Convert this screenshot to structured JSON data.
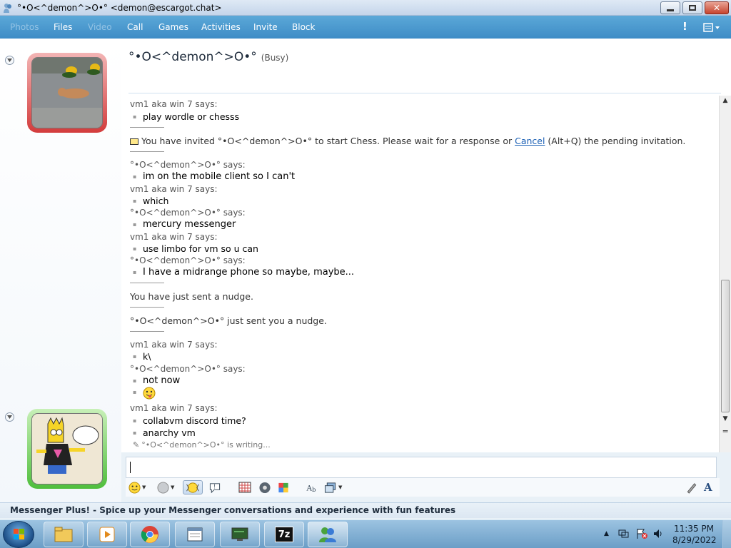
{
  "window": {
    "title": "°•Ο<^demon^>Ο•° <demon@escargot.chat>"
  },
  "menu": {
    "items": [
      {
        "label": "Photos",
        "disabled": true
      },
      {
        "label": "Files",
        "disabled": false
      },
      {
        "label": "Video",
        "disabled": true
      },
      {
        "label": "Call",
        "disabled": false
      },
      {
        "label": "Games",
        "disabled": false
      },
      {
        "label": "Activities",
        "disabled": false
      },
      {
        "label": "Invite",
        "disabled": false
      },
      {
        "label": "Block",
        "disabled": false
      }
    ],
    "alert_symbol": "!"
  },
  "contact": {
    "name": "°•Ο<^demon^>Ο•°",
    "status": "(Busy)"
  },
  "conversation": {
    "first_sender": "vm1 aka win 7 says:",
    "m1": "play wordle or chesss",
    "invite_prefix": "You have invited °•Ο<^demon^>Ο•° to start Chess. Please wait for a response or ",
    "invite_link": "Cancel",
    "invite_suffix": " (Alt+Q) the pending invitation.",
    "s2": "°•Ο<^demon^>Ο•° says:",
    "m2": "im on the mobile client so I can't",
    "s3": "vm1 aka win 7 says:",
    "m3": "which",
    "s4": "°•Ο<^demon^>Ο•° says:",
    "m4": "mercury messenger",
    "s5": "vm1 aka win 7 says:",
    "m5": "use limbo for vm so u can",
    "s6": "°•Ο<^demon^>Ο•° says:",
    "m6": "I have a midrange phone so maybe, maybe...",
    "nudge_sent": "You have just sent a nudge.",
    "nudge_received": "°•Ο<^demon^>Ο•° just sent you a nudge.",
    "s7": "vm1 aka win 7 says:",
    "m7": "k\\",
    "s8": "°•Ο<^demon^>Ο•° says:",
    "m8": "not now",
    "s9": "vm1 aka win 7 says:",
    "m9": "collabvm discord time?",
    "m10": "anarchy vm"
  },
  "typing": "°•Ο<^demon^>Ο•° is writing...",
  "plus_bar": "Messenger Plus! - Spice up your Messenger conversations and experience with fun features",
  "clock": {
    "time": "11:35 PM",
    "date": "8/29/2022"
  },
  "taskbar_apps": [
    "explorer-icon",
    "media-player-icon",
    "chrome-icon",
    "notepad-icon",
    "remote-desktop-icon",
    "7zip-icon",
    "messenger-icon"
  ],
  "taskbar_labels": {
    "sevenzip": "7z"
  }
}
